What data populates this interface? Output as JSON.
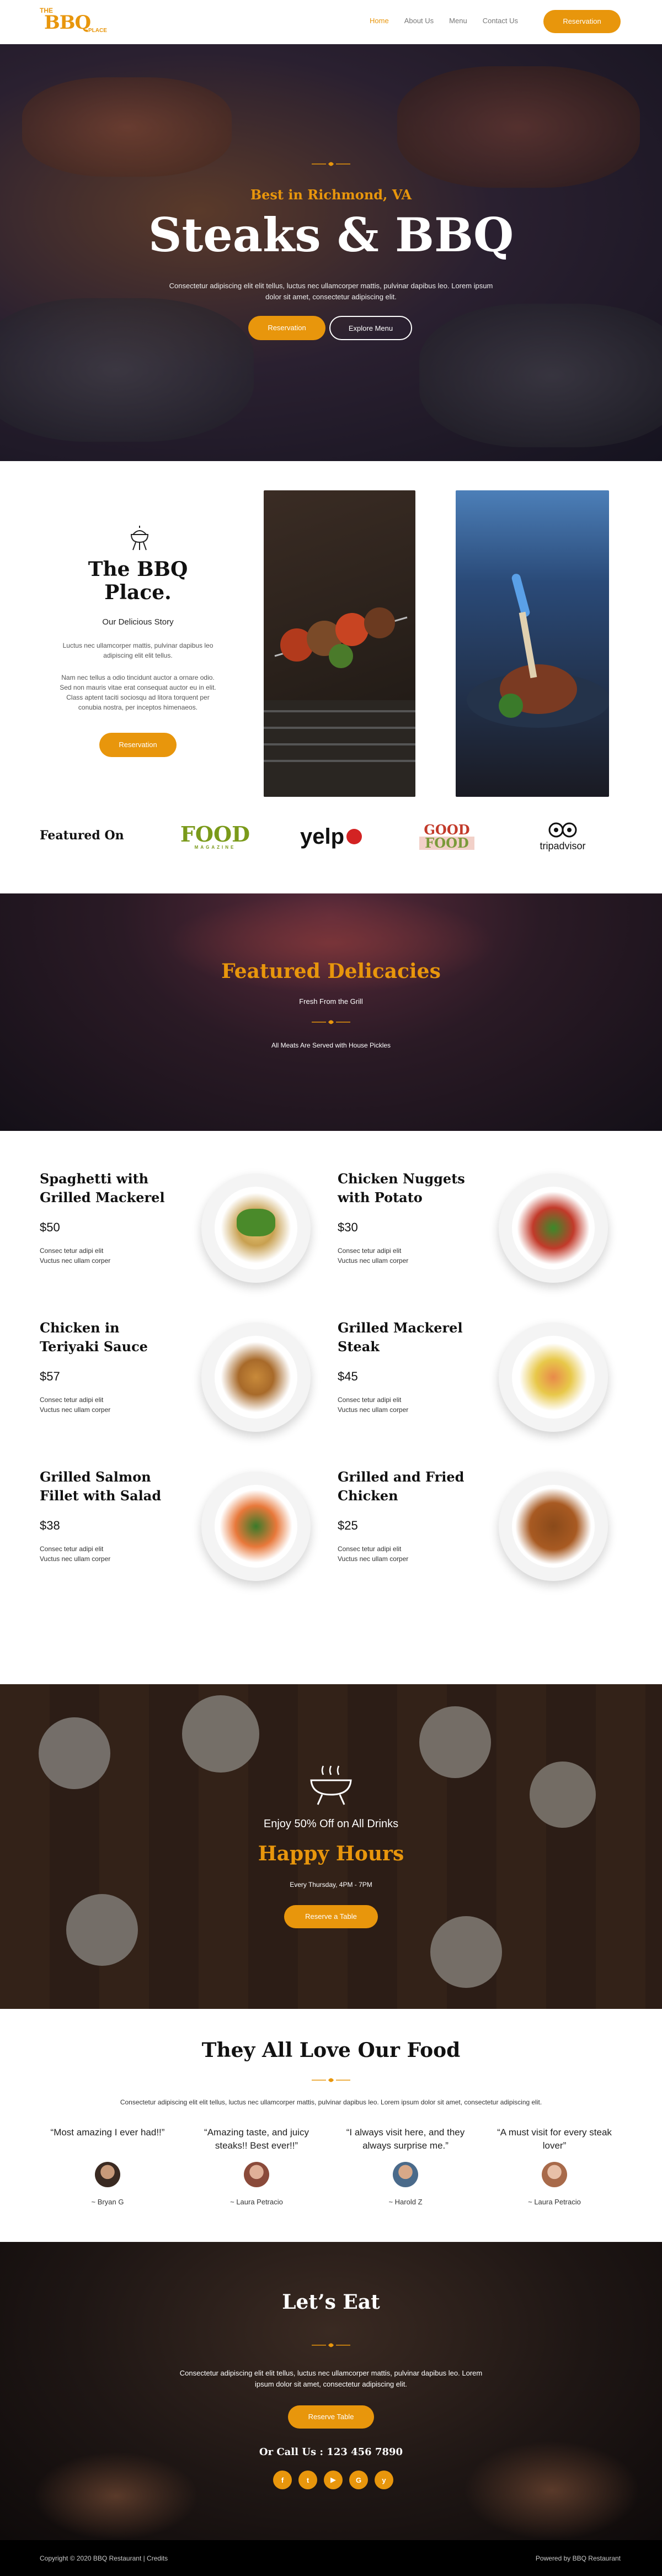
{
  "colors": {
    "accent": "#e8960c",
    "dark": "#111111",
    "footer_bg": "#000000"
  },
  "header": {
    "logo": {
      "line1": "THE",
      "line2": "BBQ",
      "line3": "PLACE"
    },
    "nav": [
      "Home",
      "About Us",
      "Menu",
      "Contact Us"
    ],
    "active_nav": "Home",
    "reservation_label": "Reservation"
  },
  "hero": {
    "subtitle": "Best in Richmond, VA",
    "title": "Steaks & BBQ",
    "text": "Consectetur adipiscing elit elit tellus, luctus nec ullamcorper mattis, pulvinar dapibus leo. Lorem ipsum dolor sit amet, consectetur adipiscing elit.",
    "reservation_label": "Reservation",
    "menu_label": "Explore Menu"
  },
  "about": {
    "icon": "grill-icon",
    "title": "The BBQ Place.",
    "subtitle": "Our Delicious Story",
    "para1": "Luctus nec ullamcorper mattis, pulvinar dapibus leo adipiscing elit elit tellus.",
    "para2": "Nam nec tellus a odio tincidunt auctor a ornare odio. Sed non mauris vitae erat consequat auctor eu in elit. Class aptent taciti sociosqu ad litora torquent per conubia nostra, per inceptos himenaeos.",
    "reservation_label": "Reservation"
  },
  "featured_on": {
    "label": "Featured On",
    "brands": [
      "FOOD",
      "MAGAZINE",
      "yelp",
      "GOOD",
      "FOOD",
      "tripadvisor"
    ]
  },
  "delicacies": {
    "title": "Featured Delicacies",
    "subtitle": "Fresh From the Grill",
    "note": "All Meats Are Served with House Pickles"
  },
  "menu": [
    {
      "name": "Spaghetti with Grilled Mackerel",
      "price": "$50",
      "desc1": "Consec tetur adipi elit",
      "desc2": "Vuctus nec ullam corper"
    },
    {
      "name": "Chicken Nuggets with Potato",
      "price": "$30",
      "desc1": "Consec tetur adipi elit",
      "desc2": "Vuctus nec ullam corper"
    },
    {
      "name": "Chicken in Teriyaki Sauce",
      "price": "$57",
      "desc1": "Consec tetur adipi elit",
      "desc2": "Vuctus nec ullam corper"
    },
    {
      "name": "Grilled Mackerel Steak",
      "price": "$45",
      "desc1": "Consec tetur adipi elit",
      "desc2": "Vuctus nec ullam corper"
    },
    {
      "name": "Grilled Salmon Fillet with Salad",
      "price": "$38",
      "desc1": "Consec tetur adipi elit",
      "desc2": "Vuctus nec ullam corper"
    },
    {
      "name": "Grilled and Fried Chicken",
      "price": "$25",
      "desc1": "Consec tetur adipi elit",
      "desc2": "Vuctus nec ullam corper"
    }
  ],
  "happy_hours": {
    "subtitle": "Enjoy 50% Off on All Drinks",
    "title": "Happy Hours",
    "time": "Every Thursday, 4PM - 7PM",
    "button_label": "Reserve a Table"
  },
  "testimonials": {
    "title": "They All Love Our Food",
    "text": "Consectetur adipiscing elit elit tellus, luctus nec ullamcorper mattis, pulvinar dapibus leo. Lorem ipsum dolor sit amet, consectetur adipiscing elit.",
    "items": [
      {
        "quote": "“Most amazing I ever had!!”",
        "name": "~ Bryan G"
      },
      {
        "quote": "“Amazing taste, and juicy steaks!! Best ever!!”",
        "name": "~ Laura Petracio"
      },
      {
        "quote": "“I always visit here, and they always surprise me.”",
        "name": "~ Harold Z"
      },
      {
        "quote": "“A must visit for every steak lover”",
        "name": "~ Laura Petracio"
      }
    ]
  },
  "lets_eat": {
    "title": "Let’s Eat",
    "text": "Consectetur adipiscing elit elit tellus, luctus nec ullamcorper mattis, pulvinar dapibus leo. Lorem ipsum dolor sit amet, consectetur adipiscing elit.",
    "button_label": "Reserve Table",
    "call": "Or Call Us : 123 456 7890",
    "socials": [
      {
        "icon": "facebook-icon",
        "glyph": "f"
      },
      {
        "icon": "twitter-icon",
        "glyph": "t"
      },
      {
        "icon": "youtube-icon",
        "glyph": "▶"
      },
      {
        "icon": "google-icon",
        "glyph": "G"
      },
      {
        "icon": "yelp-icon",
        "glyph": "y"
      }
    ]
  },
  "footer": {
    "copyright": "Copyright © 2020 BBQ Restaurant | Credits",
    "powered": "Powered by BBQ Restaurant"
  }
}
